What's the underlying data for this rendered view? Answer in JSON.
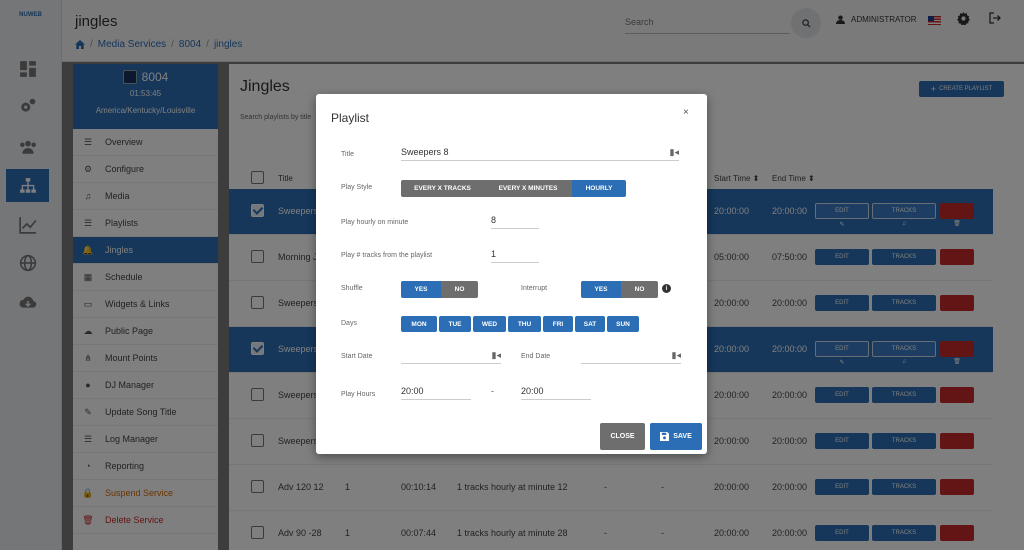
{
  "app": {
    "logo_text": "NUWEB",
    "title": "jingles",
    "breadcrumbs": [
      "Media Services",
      "8004",
      "jingles"
    ],
    "search_placeholder": "Search",
    "user": "ADMINISTRATOR"
  },
  "rail_icons": [
    "dashboard-icon",
    "gears-icon",
    "users-icon",
    "sitemap-icon",
    "chart-icon",
    "globe-icon",
    "cloud-download-icon"
  ],
  "station": {
    "name": "8004",
    "time": "01:53:45",
    "timezone": "America/Kentucky/Louisville"
  },
  "menu": [
    {
      "label": "Overview",
      "icon": "list-icon"
    },
    {
      "label": "Configure",
      "icon": "gears-icon"
    },
    {
      "label": "Media",
      "icon": "music-icon"
    },
    {
      "label": "Playlists",
      "icon": "list-icon"
    },
    {
      "label": "Jingles",
      "icon": "bell-icon"
    },
    {
      "label": "Schedule",
      "icon": "calendar-icon"
    },
    {
      "label": "Widgets & Links",
      "icon": "monitor-icon"
    },
    {
      "label": "Public Page",
      "icon": "cloud-icon"
    },
    {
      "label": "Mount Points",
      "icon": "network-icon"
    },
    {
      "label": "DJ Manager",
      "icon": "user-icon"
    },
    {
      "label": "Update Song Title",
      "icon": "edit-icon"
    },
    {
      "label": "Log Manager",
      "icon": "list-icon"
    },
    {
      "label": "Reporting",
      "icon": "pie-icon"
    },
    {
      "label": "Suspend Service",
      "icon": "lock-icon"
    },
    {
      "label": "Delete Service",
      "icon": "trash-icon"
    }
  ],
  "content": {
    "heading": "Jingles",
    "search_hint": "Search playlists by title",
    "create_label": "CREATE PLAYLIST",
    "columns": {
      "title": "Title",
      "start": "Start Time",
      "end": "End Time"
    },
    "rows": [
      {
        "title": "Sweepers",
        "tracks": "",
        "duration": "",
        "desc": "",
        "start": "20:00:00",
        "end": "20:00:00",
        "selected": true
      },
      {
        "title": "Morning J",
        "tracks": "",
        "duration": "",
        "desc": "",
        "start": "05:00:00",
        "end": "07:50:00",
        "selected": false
      },
      {
        "title": "Sweepers",
        "tracks": "",
        "duration": "",
        "desc": "",
        "start": "20:00:00",
        "end": "20:00:00",
        "selected": false
      },
      {
        "title": "Sweepers",
        "tracks": "",
        "duration": "",
        "desc": "",
        "start": "20:00:00",
        "end": "20:00:00",
        "selected": true
      },
      {
        "title": "Sweepers",
        "tracks": "",
        "duration": "",
        "desc": "",
        "start": "20:00:00",
        "end": "20:00:00",
        "selected": false
      },
      {
        "title": "Sweepers",
        "tracks": "",
        "duration": "",
        "desc": "",
        "start": "20:00:00",
        "end": "20:00:00",
        "selected": false
      },
      {
        "title": "Adv 120 12",
        "tracks": "1",
        "duration": "00:10:14",
        "desc": "1 tracks hourly at minute 12",
        "d1": "-",
        "d2": "-",
        "start": "20:00:00",
        "end": "20:00:00",
        "selected": false
      },
      {
        "title": "Adv 90 -28",
        "tracks": "1",
        "duration": "00:07:44",
        "desc": "1 tracks hourly at minute 28",
        "d1": "-",
        "d2": "-",
        "start": "20:00:00",
        "end": "20:00:00",
        "selected": false
      }
    ],
    "edit_label": "EDIT",
    "tracks_label": "TRACKS"
  },
  "modal": {
    "title": "Playlist",
    "close_x": "×",
    "title_label": "Title",
    "title_value": "Sweepers 8",
    "play_style_label": "Play Style",
    "play_style_options": [
      "EVERY X TRACKS",
      "EVERY X MINUTES",
      "HOURLY"
    ],
    "play_style_selected": "HOURLY",
    "minute_label": "Play hourly on minute",
    "minute_value": "8",
    "tracks_label": "Play # tracks from the playlist",
    "tracks_value": "1",
    "shuffle_label": "Shuffle",
    "shuffle_options": [
      "YES",
      "NO"
    ],
    "shuffle_selected": "YES",
    "interrupt_label": "Interrupt",
    "interrupt_options": [
      "YES",
      "NO"
    ],
    "interrupt_selected": "YES",
    "days_label": "Days",
    "days": [
      "MON",
      "TUE",
      "WED",
      "THU",
      "FRI",
      "SAT",
      "SUN"
    ],
    "start_date_label": "Start Date",
    "end_date_label": "End Date",
    "play_hours_label": "Play Hours",
    "play_hours_from": "20:00",
    "play_hours_dash": "-",
    "play_hours_to": "20:00",
    "close_label": "CLOSE",
    "save_label": "SAVE"
  },
  "colors": {
    "primary": "#2c6eb5",
    "danger": "#c62828",
    "neutral": "#6e6e6e",
    "warning": "#d46b00"
  }
}
